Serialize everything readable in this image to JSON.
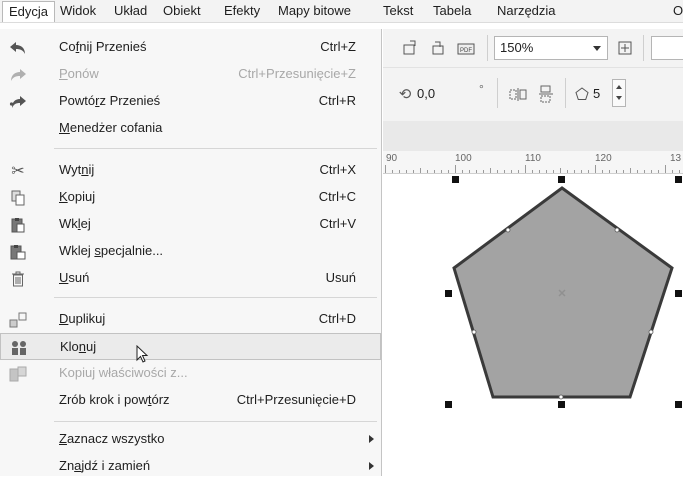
{
  "menubar": {
    "items": [
      "Edycja",
      "Widok",
      "Układ",
      "Obiekt",
      "Efekty",
      "Mapy bitowe",
      "Tekst",
      "Tabela",
      "Narzędzia",
      "O"
    ]
  },
  "toolbar": {
    "zoom_value": "150%",
    "rotation_value": "0,0",
    "degree_symbol": "°",
    "sides_value": "5"
  },
  "ruler": {
    "labels": [
      "90",
      "100",
      "110",
      "120",
      "13"
    ]
  },
  "menu": {
    "items": [
      {
        "label": "Cofnij Przenieś",
        "shortcut": "Ctrl+Z",
        "icon": "undo-icon",
        "enabled": true
      },
      {
        "label": "Ponów",
        "shortcut": "Ctrl+Przesunięcie+Z",
        "icon": "redo-icon",
        "enabled": false
      },
      {
        "label": "Powtórz Przenieś",
        "shortcut": "Ctrl+R",
        "icon": "repeat-icon",
        "enabled": true
      },
      {
        "label": "Menedżer cofania",
        "shortcut": "",
        "icon": "",
        "enabled": true
      },
      {
        "label": "Wytnij",
        "shortcut": "Ctrl+X",
        "icon": "scissors-icon",
        "enabled": true
      },
      {
        "label": "Kopiuj",
        "shortcut": "Ctrl+C",
        "icon": "copy-icon",
        "enabled": true
      },
      {
        "label": "Wklej",
        "shortcut": "Ctrl+V",
        "icon": "paste-icon",
        "enabled": true
      },
      {
        "label": "Wklej specjalnie...",
        "shortcut": "",
        "icon": "paste-special-icon",
        "enabled": true
      },
      {
        "label": "Usuń",
        "shortcut": "Usuń",
        "icon": "trash-icon",
        "enabled": true
      },
      {
        "label": "Duplikuj",
        "shortcut": "Ctrl+D",
        "icon": "duplicate-icon",
        "enabled": true
      },
      {
        "label": "Klonuj",
        "shortcut": "",
        "icon": "clone-icon",
        "enabled": true
      },
      {
        "label": "Kopiuj właściwości z...",
        "shortcut": "",
        "icon": "copy-properties-icon",
        "enabled": false
      },
      {
        "label": "Zrób krok i powtórz",
        "shortcut": "Ctrl+Przesunięcie+D",
        "icon": "",
        "enabled": true
      },
      {
        "label": "Zaznacz wszystko",
        "shortcut": "",
        "icon": "",
        "enabled": true
      },
      {
        "label": "Znajdź i zamień",
        "shortcut": "",
        "icon": "",
        "enabled": true
      }
    ]
  },
  "colors": {
    "shape_fill": "#a3a3a3",
    "shape_stroke": "#3a3a3a",
    "highlight": "#ebebeb"
  }
}
